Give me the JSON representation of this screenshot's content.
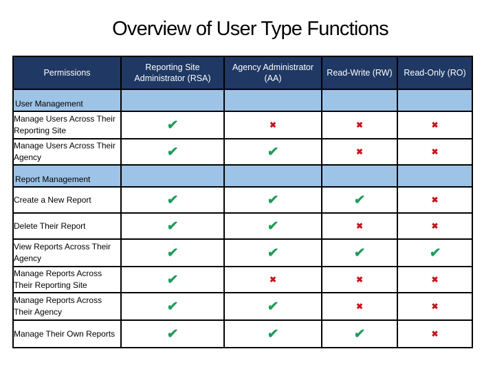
{
  "title": "Overview of User Type Functions",
  "colors": {
    "header_bg": "#1f3864",
    "section_bg": "#9dc3e6",
    "check": "#1e9c58",
    "cross": "#c4161c"
  },
  "icons": {
    "yes": "✔",
    "no": "✖"
  },
  "table": {
    "headers": [
      "Permissions",
      "Reporting Site Administrator (RSA)",
      "Agency Administrator (AA)",
      "Read-Write (RW)",
      "Read-Only (RO)"
    ],
    "sections": [
      {
        "label": "User Management",
        "rows": [
          {
            "permission": "Manage Users Across Their Reporting Site",
            "rsa": true,
            "aa": false,
            "rw": false,
            "ro": false
          },
          {
            "permission": "Manage Users Across Their Agency",
            "rsa": true,
            "aa": true,
            "rw": false,
            "ro": false
          }
        ]
      },
      {
        "label": "Report Management",
        "rows": [
          {
            "permission": "Create a New Report",
            "rsa": true,
            "aa": true,
            "rw": true,
            "ro": false
          },
          {
            "permission": "Delete Their Report",
            "rsa": true,
            "aa": true,
            "rw": false,
            "ro": false
          },
          {
            "permission": "View Reports Across Their Agency",
            "rsa": true,
            "aa": true,
            "rw": true,
            "ro": true
          },
          {
            "permission": "Manage Reports Across Their Reporting Site",
            "rsa": true,
            "aa": false,
            "rw": false,
            "ro": false
          },
          {
            "permission": "Manage Reports Across Their Agency",
            "rsa": true,
            "aa": true,
            "rw": false,
            "ro": false
          },
          {
            "permission": "Manage Their Own Reports",
            "rsa": true,
            "aa": true,
            "rw": true,
            "ro": false
          }
        ]
      }
    ]
  }
}
